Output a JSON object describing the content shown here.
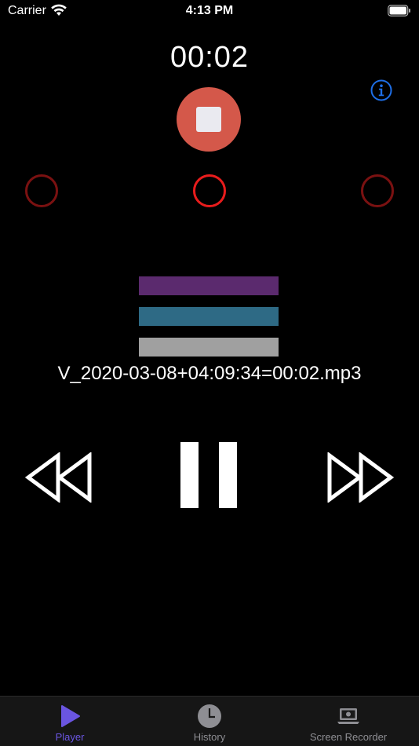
{
  "status_bar": {
    "carrier": "Carrier",
    "time": "4:13 PM"
  },
  "player": {
    "elapsed": "00:02",
    "filename": "V_2020-03-08+04:09:34=00:02.mp3"
  },
  "colors": {
    "background": "#000000",
    "stop_button": "#d4584a",
    "ring_active": "#e81c1c",
    "ring_inactive": "#7a1111",
    "info_accent": "#1e6fe8",
    "bar_top": "#5b2a6e",
    "bar_middle": "#2e6a85",
    "bar_bottom": "#a0a0a0",
    "tab_selected": "#6a55e0",
    "tab_unselected": "#8e8e93"
  },
  "icons": {
    "info": "info-icon",
    "stop": "stop-icon",
    "rewind": "rewind-icon",
    "pause": "pause-icon",
    "fast_forward": "fast-forward-icon",
    "player_tab": "play-icon",
    "history_tab": "clock-icon",
    "recorder_tab": "laptop-icon"
  },
  "tabs": [
    {
      "label": "Player",
      "selected": true
    },
    {
      "label": "History",
      "selected": false
    },
    {
      "label": "Screen Recorder",
      "selected": false
    }
  ]
}
